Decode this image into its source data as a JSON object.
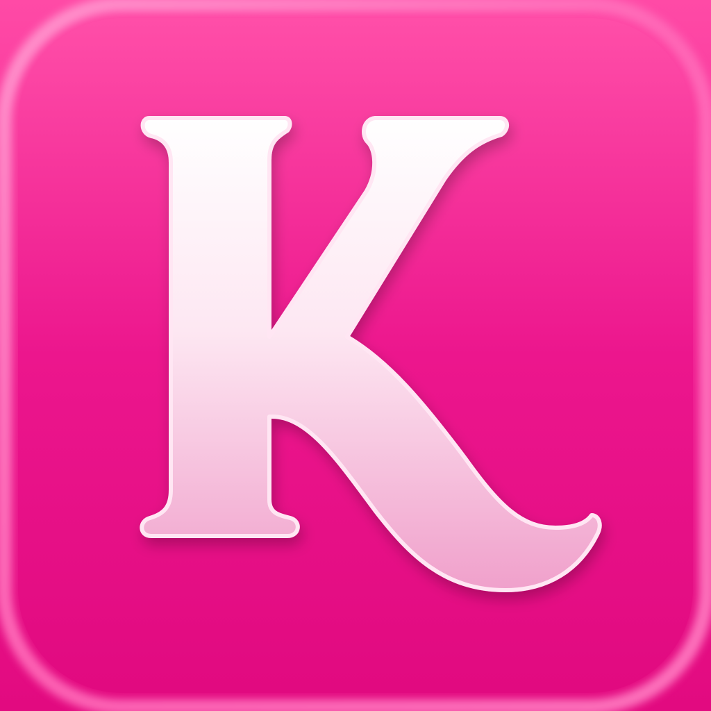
{
  "app_icon": {
    "letter": "K",
    "colors": {
      "background_top": "#ff4aa6",
      "background_bottom": "#e20a80",
      "rim_highlight": "#ff8fcb",
      "letter_top": "#ffffff",
      "letter_bottom": "#f2a4cd",
      "letter_outline": "#ffe6f3"
    }
  }
}
